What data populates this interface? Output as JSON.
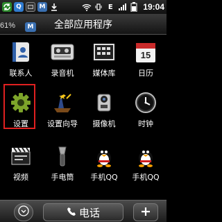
{
  "status_bar": {
    "time": "19:04",
    "badges": [
      "Q",
      "M"
    ],
    "signal_label": "E"
  },
  "drawer": {
    "title": "全部应用程序",
    "battery_percent": "61%",
    "badge": "M"
  },
  "apps": [
    {
      "label": "联系人",
      "icon": "contacts-icon"
    },
    {
      "label": "录音机",
      "icon": "recorder-icon"
    },
    {
      "label": "媒体库",
      "icon": "media-library-icon"
    },
    {
      "label": "日历",
      "icon": "calendar-icon",
      "icon_text": "15"
    },
    {
      "label": "设置",
      "icon": "settings-gear-icon",
      "selected": true
    },
    {
      "label": "设置向导",
      "icon": "setup-wizard-icon"
    },
    {
      "label": "摄像机",
      "icon": "camcorder-icon"
    },
    {
      "label": "时钟",
      "icon": "clock-icon"
    },
    {
      "label": "视频",
      "icon": "video-icon"
    },
    {
      "label": "手电筒",
      "icon": "flashlight-icon"
    },
    {
      "label": "手机QQ",
      "icon": "qq-penguin-icon"
    },
    {
      "label": "手机QQ",
      "icon": "qq-penguin-icon"
    }
  ],
  "dock": {
    "call_label": "电话"
  },
  "colors": {
    "selection": "#e02020",
    "gear": "#7da42a"
  }
}
